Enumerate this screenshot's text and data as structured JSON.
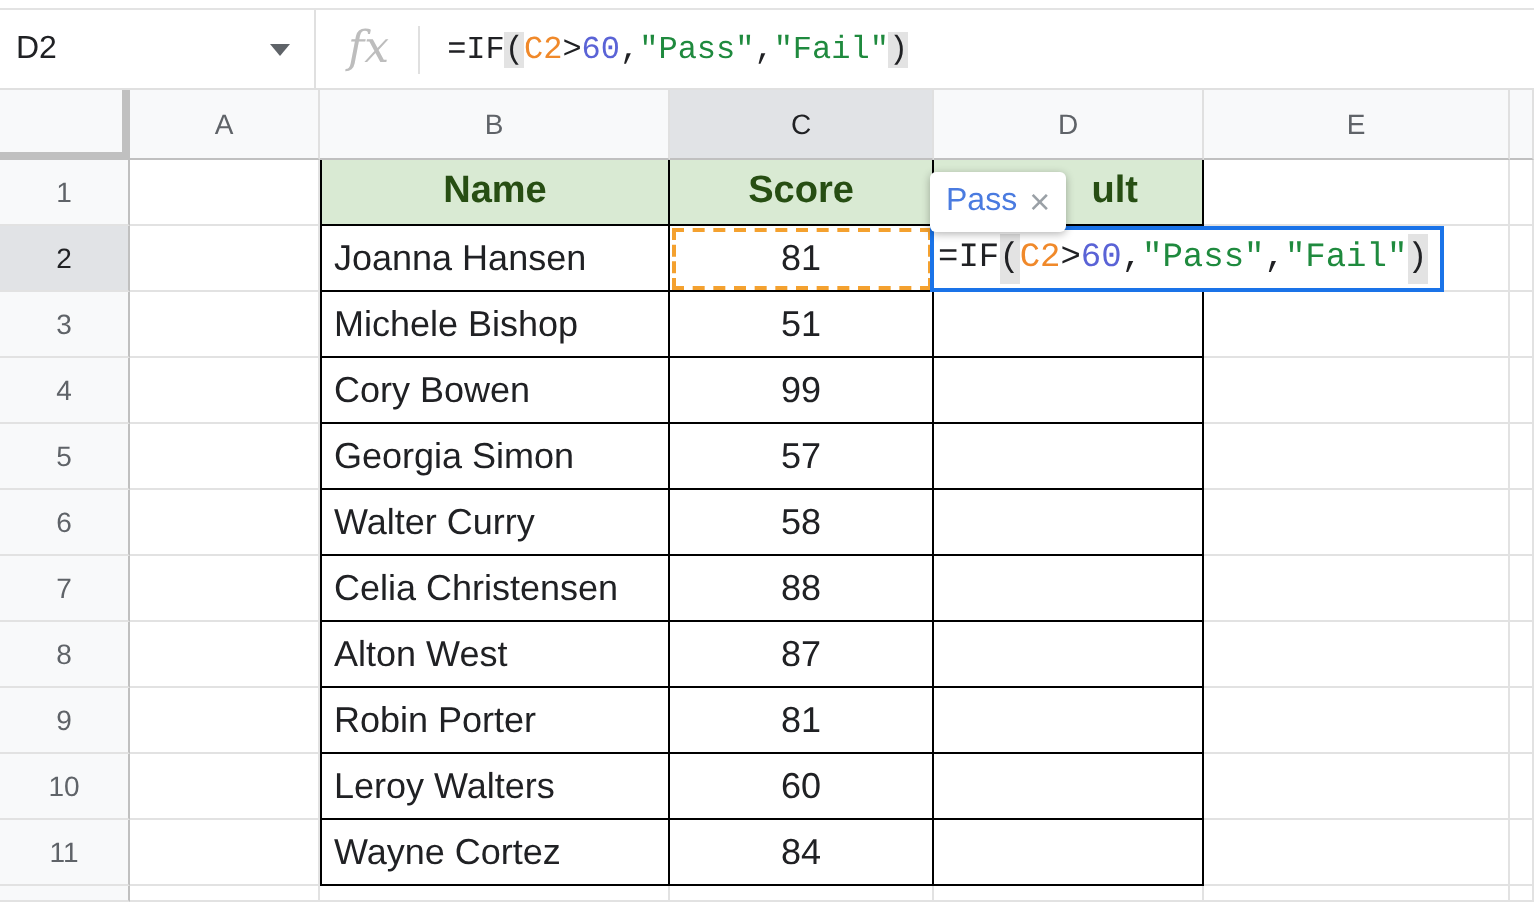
{
  "formula_bar": {
    "name_box": "D2",
    "function_icon": "fx",
    "formula": [
      {
        "text": "=IF",
        "kind": "op"
      },
      {
        "text": "(",
        "kind": "paren"
      },
      {
        "text": "C2",
        "kind": "ref"
      },
      {
        "text": ">",
        "kind": "op"
      },
      {
        "text": "60",
        "kind": "number"
      },
      {
        "text": ",",
        "kind": "op"
      },
      {
        "text": "\"Pass\"",
        "kind": "string"
      },
      {
        "text": ",",
        "kind": "op"
      },
      {
        "text": "\"Fail\"",
        "kind": "string"
      },
      {
        "text": ")",
        "kind": "paren"
      }
    ]
  },
  "columns": [
    {
      "label": "A",
      "selected": false
    },
    {
      "label": "B",
      "selected": false
    },
    {
      "label": "C",
      "selected": true
    },
    {
      "label": "D",
      "selected": false
    },
    {
      "label": "E",
      "selected": false
    }
  ],
  "table": {
    "headers": [
      "Name",
      "Score",
      "ult"
    ],
    "rows": [
      {
        "row": "2",
        "selected": true,
        "name": "Joanna Hansen",
        "score": "81",
        "copied": true,
        "editing": true
      },
      {
        "row": "3",
        "selected": false,
        "name": "Michele Bishop",
        "score": "51",
        "copied": false
      },
      {
        "row": "4",
        "selected": false,
        "name": "Cory Bowen",
        "score": "99",
        "copied": false
      },
      {
        "row": "5",
        "selected": false,
        "name": "Georgia Simon",
        "score": "57",
        "copied": false
      },
      {
        "row": "6",
        "selected": false,
        "name": "Walter Curry",
        "score": "58",
        "copied": false
      },
      {
        "row": "7",
        "selected": false,
        "name": "Celia Christensen",
        "score": "88",
        "copied": false
      },
      {
        "row": "8",
        "selected": false,
        "name": "Alton West",
        "score": "87",
        "copied": false
      },
      {
        "row": "9",
        "selected": false,
        "name": "Robin Porter",
        "score": "81",
        "copied": false
      },
      {
        "row": "10",
        "selected": false,
        "name": "Leroy Walters",
        "score": "60",
        "copied": false
      },
      {
        "row": "11",
        "selected": false,
        "name": "Wayne Cortez",
        "score": "84",
        "copied": false
      }
    ]
  },
  "header_row": "1",
  "editor": {
    "formula": [
      {
        "text": "=IF",
        "kind": "op"
      },
      {
        "text": "(",
        "kind": "paren"
      },
      {
        "text": "C2",
        "kind": "ref"
      },
      {
        "text": ">",
        "kind": "op"
      },
      {
        "text": "60",
        "kind": "number"
      },
      {
        "text": ",",
        "kind": "op"
      },
      {
        "text": "\"Pass\"",
        "kind": "string"
      },
      {
        "text": ",",
        "kind": "op"
      },
      {
        "text": "\"Fail\"",
        "kind": "string"
      },
      {
        "text": ")",
        "kind": "paren"
      }
    ]
  },
  "tooltip": {
    "text": "Pass",
    "close": "×"
  }
}
